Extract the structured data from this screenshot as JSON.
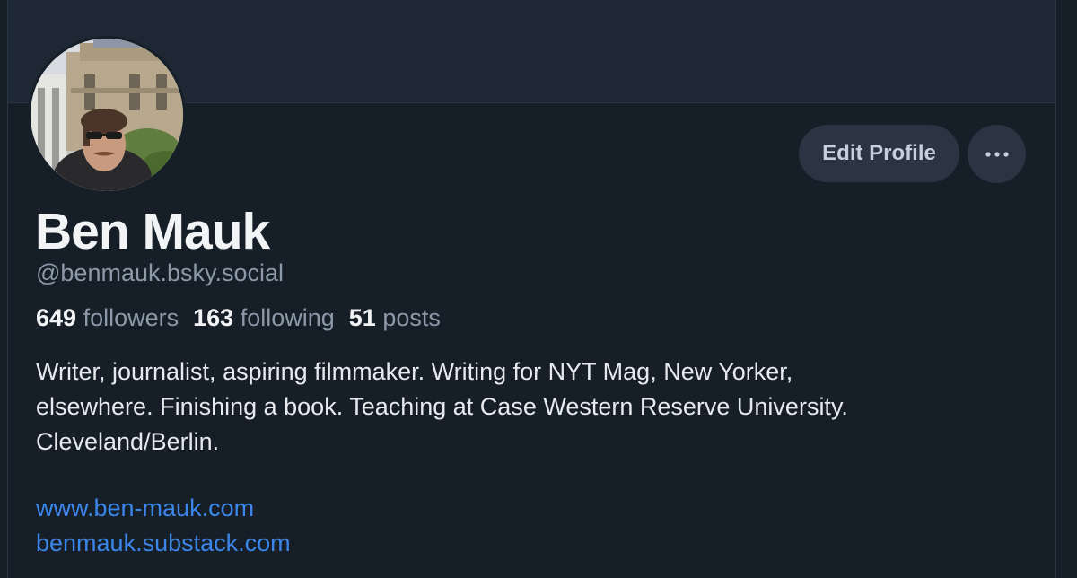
{
  "profile": {
    "name": "Ben Mauk",
    "handle": "@benmauk.bsky.social",
    "stats": {
      "followers_count": "649",
      "followers_label": "followers",
      "following_count": "163",
      "following_label": "following",
      "posts_count": "51",
      "posts_label": "posts"
    },
    "bio_lines": [
      "Writer, journalist, aspiring filmmaker. Writing for NYT Mag, New Yorker,",
      "elsewhere. Finishing a book. Teaching at Case Western Reserve University.",
      "Cleveland/Berlin."
    ],
    "links": [
      "www.ben-mauk.com",
      "benmauk.substack.com"
    ]
  },
  "actions": {
    "edit_profile_label": "Edit Profile",
    "more_icon": "ellipsis-icon"
  },
  "colors": {
    "background": "#161e27",
    "banner": "#1e2734",
    "button_bg": "#2a3442",
    "link": "#3b86e8",
    "secondary_text": "#8c99a8",
    "primary_text": "#f1f3f5"
  }
}
